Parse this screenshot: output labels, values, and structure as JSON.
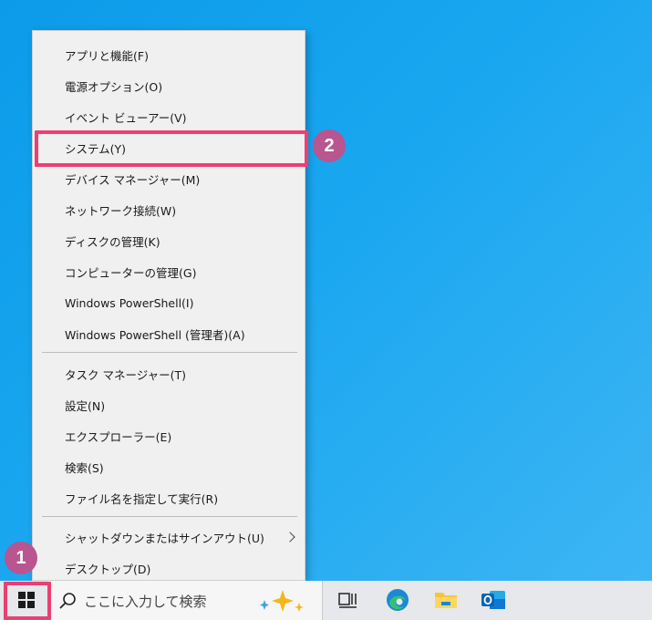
{
  "menu": {
    "items": [
      {
        "label": "アプリと機能(F)"
      },
      {
        "label": "電源オプション(O)"
      },
      {
        "label": "イベント ビューアー(V)"
      },
      {
        "label": "システム(Y)"
      },
      {
        "label": "デバイス マネージャー(M)"
      },
      {
        "label": "ネットワーク接続(W)"
      },
      {
        "label": "ディスクの管理(K)"
      },
      {
        "label": "コンピューターの管理(G)"
      },
      {
        "label": "Windows PowerShell(I)"
      },
      {
        "label": "Windows PowerShell (管理者)(A)"
      },
      {
        "label": "タスク マネージャー(T)"
      },
      {
        "label": "設定(N)"
      },
      {
        "label": "エクスプローラー(E)"
      },
      {
        "label": "検索(S)"
      },
      {
        "label": "ファイル名を指定して実行(R)"
      },
      {
        "label": "シャットダウンまたはサインアウト(U)"
      },
      {
        "label": "デスクトップ(D)"
      }
    ]
  },
  "annotations": {
    "step1": "1",
    "step2": "2",
    "highlight_color": "#ec3f74",
    "badge_color": "#b9558f"
  },
  "taskbar": {
    "search_placeholder": "ここに入力して検索",
    "icons": [
      "windows-logo-icon",
      "search-icon",
      "sparkle-icon",
      "task-view-icon",
      "edge-icon",
      "file-explorer-icon",
      "outlook-icon"
    ]
  }
}
